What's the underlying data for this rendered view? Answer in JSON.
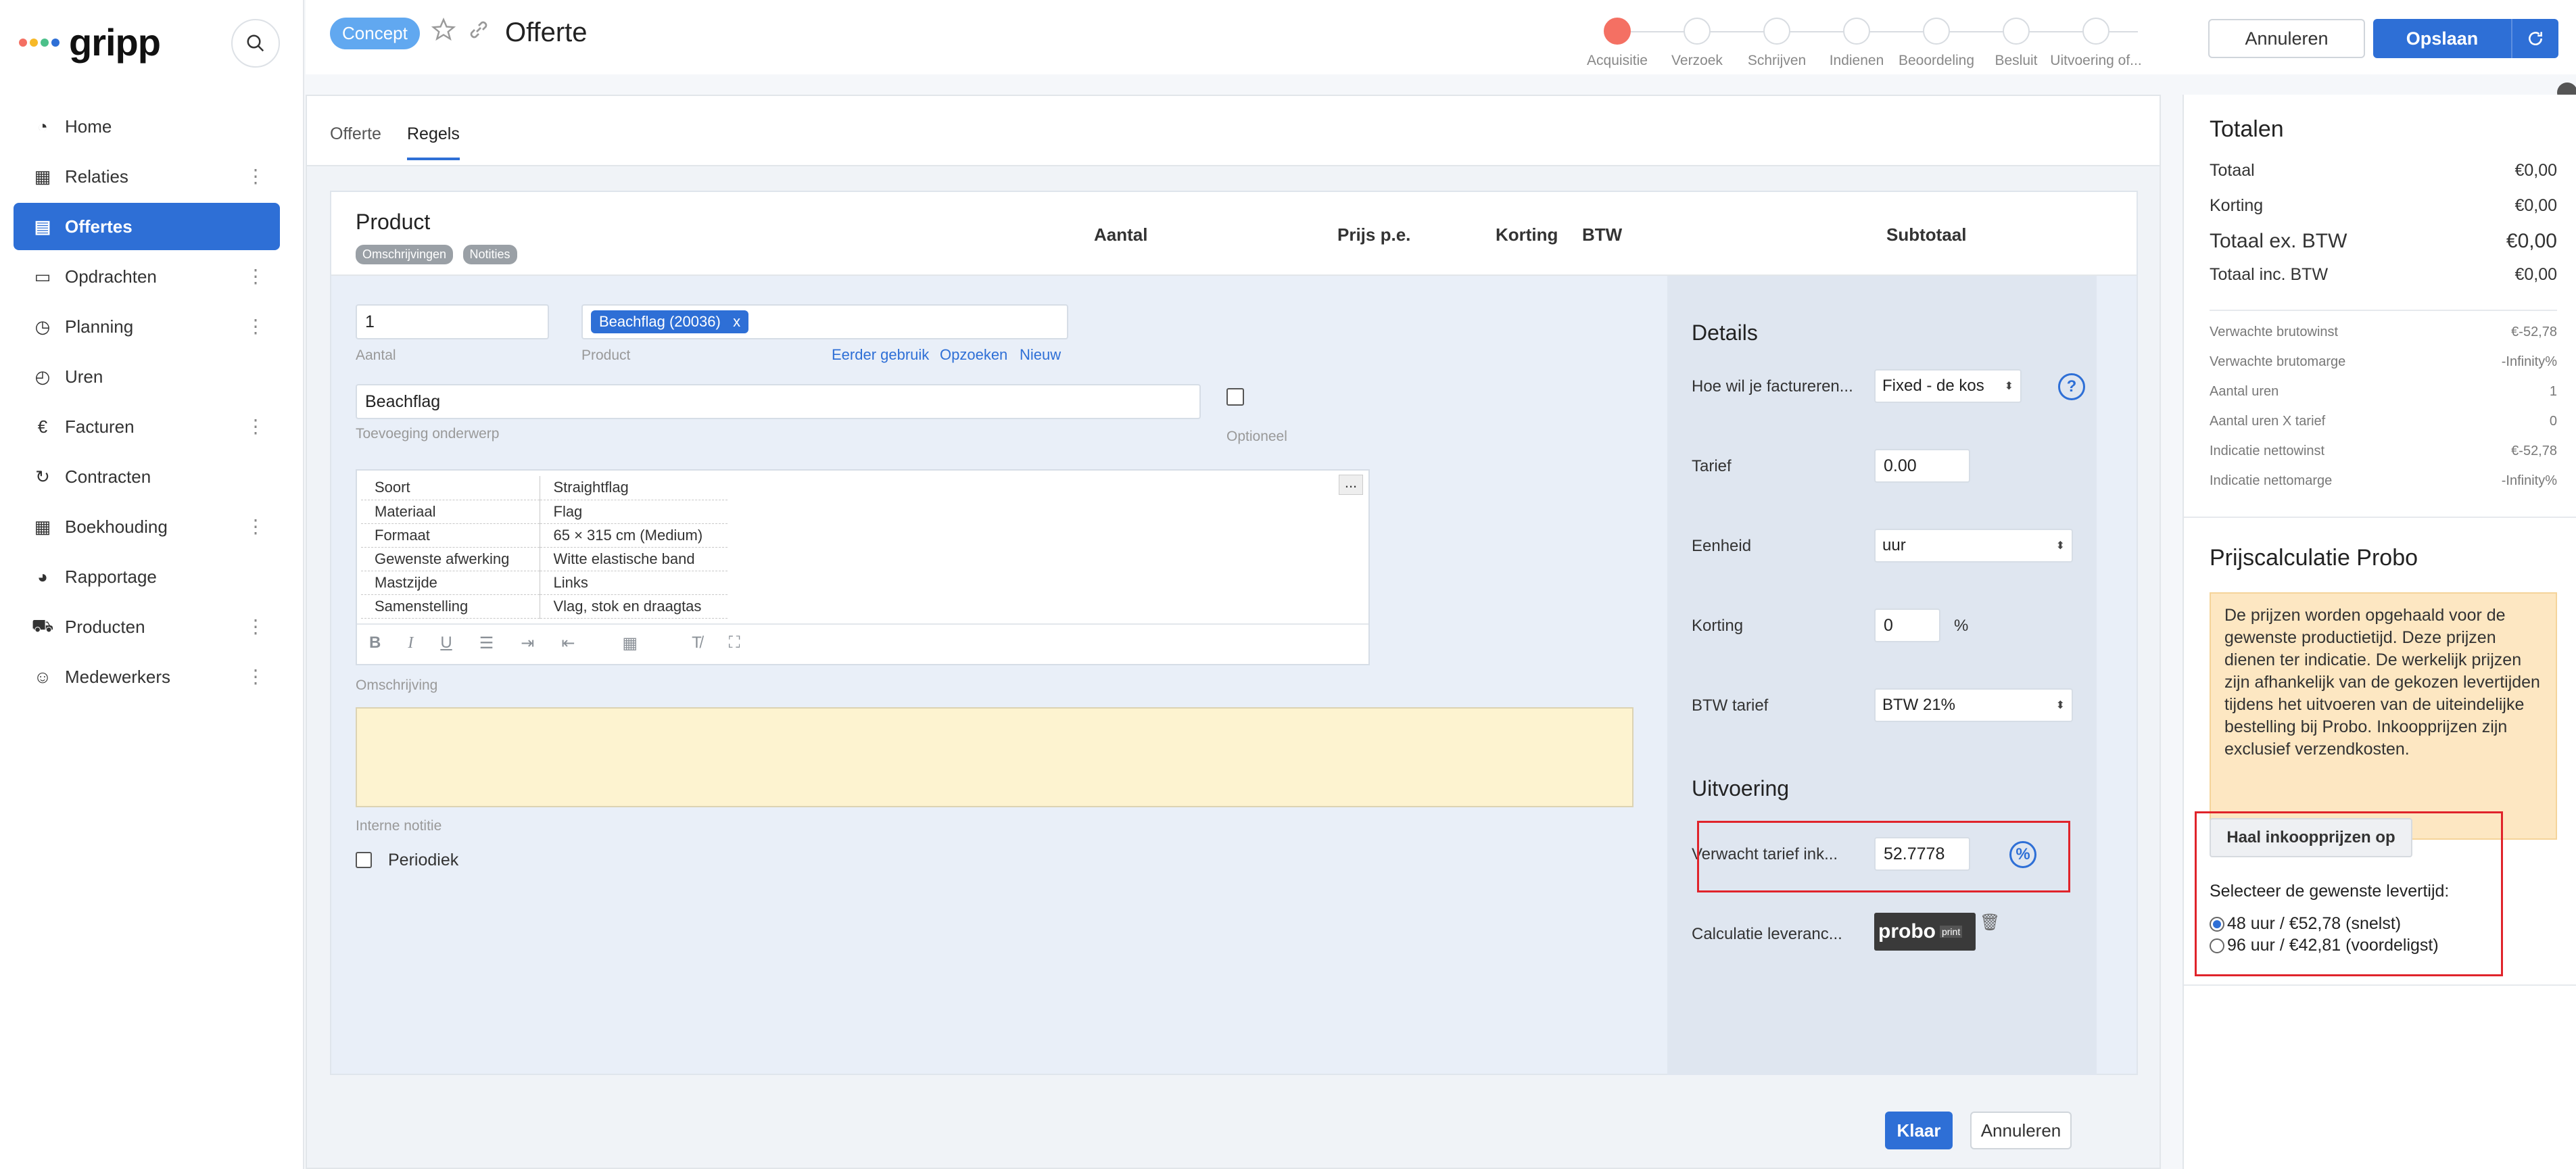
{
  "app": {
    "logo_text": "gripp"
  },
  "sidebar": {
    "items": [
      {
        "label": "Home",
        "icon": "gauge-icon",
        "glyph": "◔",
        "menu": false,
        "active": false
      },
      {
        "label": "Relaties",
        "icon": "building-icon",
        "glyph": "▦",
        "menu": true,
        "active": false
      },
      {
        "label": "Offertes",
        "icon": "document-icon",
        "glyph": "▤",
        "menu": false,
        "active": true
      },
      {
        "label": "Opdrachten",
        "icon": "clipboard-icon",
        "glyph": "▭",
        "menu": true,
        "active": false
      },
      {
        "label": "Planning",
        "icon": "clock-icon",
        "glyph": "◷",
        "menu": true,
        "active": false
      },
      {
        "label": "Uren",
        "icon": "stopwatch-icon",
        "glyph": "◴",
        "menu": false,
        "active": false
      },
      {
        "label": "Facturen",
        "icon": "euro-icon",
        "glyph": "€",
        "menu": true,
        "active": false
      },
      {
        "label": "Contracten",
        "icon": "refresh-icon",
        "glyph": "↻",
        "menu": false,
        "active": false
      },
      {
        "label": "Boekhouding",
        "icon": "grid-icon",
        "glyph": "▦",
        "menu": true,
        "active": false
      },
      {
        "label": "Rapportage",
        "icon": "pie-chart-icon",
        "glyph": "◕",
        "menu": false,
        "active": false
      },
      {
        "label": "Producten",
        "icon": "cart-icon",
        "glyph": "⛟",
        "menu": true,
        "active": false
      },
      {
        "label": "Medewerkers",
        "icon": "users-icon",
        "glyph": "☺",
        "menu": true,
        "active": false
      }
    ]
  },
  "header": {
    "status_badge": "Concept",
    "title": "Offerte",
    "steps": [
      "Acquisitie",
      "Verzoek",
      "Schrijven",
      "Indienen",
      "Beoordeling",
      "Besluit",
      "Uitvoering of..."
    ],
    "active_step": 0,
    "cancel_label": "Annuleren",
    "save_label": "Opslaan"
  },
  "tabs": [
    {
      "label": "Offerte",
      "active": false
    },
    {
      "label": "Regels",
      "active": true
    }
  ],
  "table_header": {
    "product": "Product",
    "chips": [
      "Omschrijvingen",
      "Notities"
    ],
    "columns": [
      "Aantal",
      "Prijs p.e.",
      "Korting",
      "BTW",
      "Subtotaal"
    ]
  },
  "line_edit": {
    "quantity": "1",
    "quantity_label": "Aantal",
    "product_tag": "Beachflag (20036)",
    "product_tag_remove": "x",
    "product_label": "Product",
    "links": [
      "Eerder gebruik",
      "Opzoeken",
      "Nieuw"
    ],
    "subject": "Beachflag",
    "subject_label": "Toevoeging onderwerp",
    "optional_label": "Optioneel",
    "spec_rows": [
      [
        "Soort",
        "Straightflag"
      ],
      [
        "Materiaal",
        "Flag"
      ],
      [
        "Formaat",
        "65 × 315 cm (Medium)"
      ],
      [
        "Gewenste afwerking",
        "Witte elastische band"
      ],
      [
        "Mastzijde",
        "Links"
      ],
      [
        "Samenstelling",
        "Vlag, stok en draagtas"
      ]
    ],
    "more_label": "...",
    "description_label": "Omschrijving",
    "internal_note_label": "Interne notitie",
    "periodic_label": "Periodiek",
    "done_label": "Klaar",
    "cancel_label": "Annuleren"
  },
  "details": {
    "title": "Details",
    "billing_label": "Hoe wil je factureren...",
    "billing_value": "Fixed - de kos",
    "help_label": "?",
    "rate_label": "Tarief",
    "rate_value": "0.00",
    "unit_label": "Eenheid",
    "unit_value": "uur",
    "discount_label": "Korting",
    "discount_value": "0",
    "discount_unit": "%",
    "vat_label": "BTW tarief",
    "vat_value": "BTW 21%",
    "execution_title": "Uitvoering",
    "expected_rate_label": "Verwacht tarief ink...",
    "expected_rate_value": "52.7778",
    "percent_label": "%",
    "supplier_label": "Calculatie leveranc...",
    "supplier_logo": "probo",
    "supplier_logo_sub": "print"
  },
  "totals": {
    "title": "Totalen",
    "rows": [
      {
        "label": "Totaal",
        "value": "€0,00"
      },
      {
        "label": "Korting",
        "value": "€0,00"
      },
      {
        "label": "Totaal ex. BTW",
        "value": "€0,00"
      },
      {
        "label": "Totaal inc. BTW",
        "value": "€0,00"
      }
    ],
    "metrics": [
      {
        "label": "Verwachte brutowinst",
        "value": "€-52,78"
      },
      {
        "label": "Verwachte brutomarge",
        "value": "-Infinity%"
      },
      {
        "label": "Aantal uren",
        "value": "1"
      },
      {
        "label": "Aantal uren X tarief",
        "value": "0"
      },
      {
        "label": "Indicatie nettowinst",
        "value": "€-52,78"
      },
      {
        "label": "Indicatie nettomarge",
        "value": "-Infinity%"
      }
    ]
  },
  "probo": {
    "title": "Prijscalculatie Probo",
    "notice": "De prijzen worden opgehaald voor de gewenste productietijd. Deze prijzen dienen ter indicatie. De werkelijk prijzen zijn afhankelijk van de gekozen levertijden tijdens het uitvoeren van de uiteindelijke bestelling bij Probo. Inkoopprijzen zijn exclusief verzendkosten.",
    "fetch_label": "Haal inkoopprijzen op",
    "select_label": "Selecteer de gewenste levertijd:",
    "options": [
      {
        "label": "48 uur / €52,78 (snelst)",
        "selected": true
      },
      {
        "label": "96 uur / €42,81 (voordeligst)",
        "selected": false
      }
    ]
  },
  "colors": {
    "accent": "#2e6fd6",
    "step_active": "#f47063",
    "highlight": "#e0242b",
    "notice_bg": "#fde7c2"
  }
}
